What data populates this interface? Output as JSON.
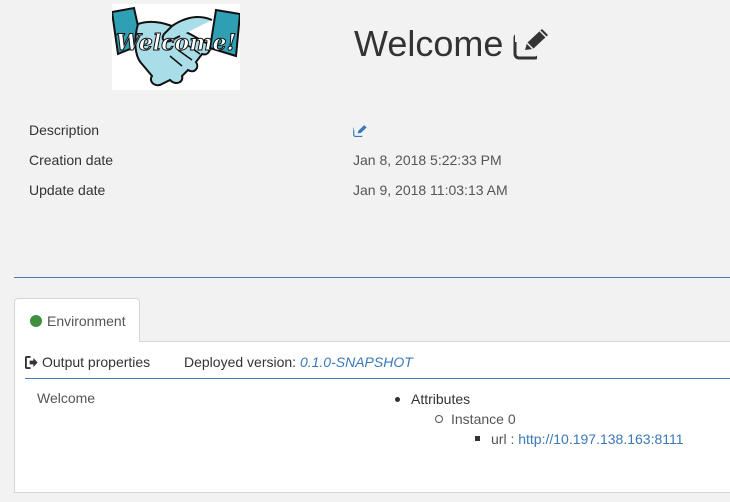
{
  "header": {
    "logo_text": "Welcome!",
    "title": "Welcome",
    "title_edit_icon": "edit-icon"
  },
  "properties": [
    {
      "label": "Description",
      "value": "",
      "icon": "edit-icon"
    },
    {
      "label": "Creation date",
      "value": "Jan 8, 2018 5:22:33 PM"
    },
    {
      "label": "Update date",
      "value": "Jan 9, 2018 11:03:13 AM"
    }
  ],
  "tabs": [
    {
      "label": "Environment",
      "status": "deployed",
      "status_color": "#3f8f3f",
      "active": true
    }
  ],
  "panel": {
    "output_button": {
      "label": "Output properties",
      "icon": "sign-out-icon"
    },
    "deployed_label": "Deployed version:",
    "deployed_version": "0.1.0-SNAPSHOT",
    "output_name": "Welcome",
    "attributes": {
      "label": "Attributes",
      "instance": "Instance 0",
      "url_key": "url :",
      "url_value": "http://10.197.138.163:8111"
    }
  },
  "colors": {
    "accent": "#3a78b8",
    "divider": "#4a7bb7",
    "background": "#f2f2f2"
  }
}
